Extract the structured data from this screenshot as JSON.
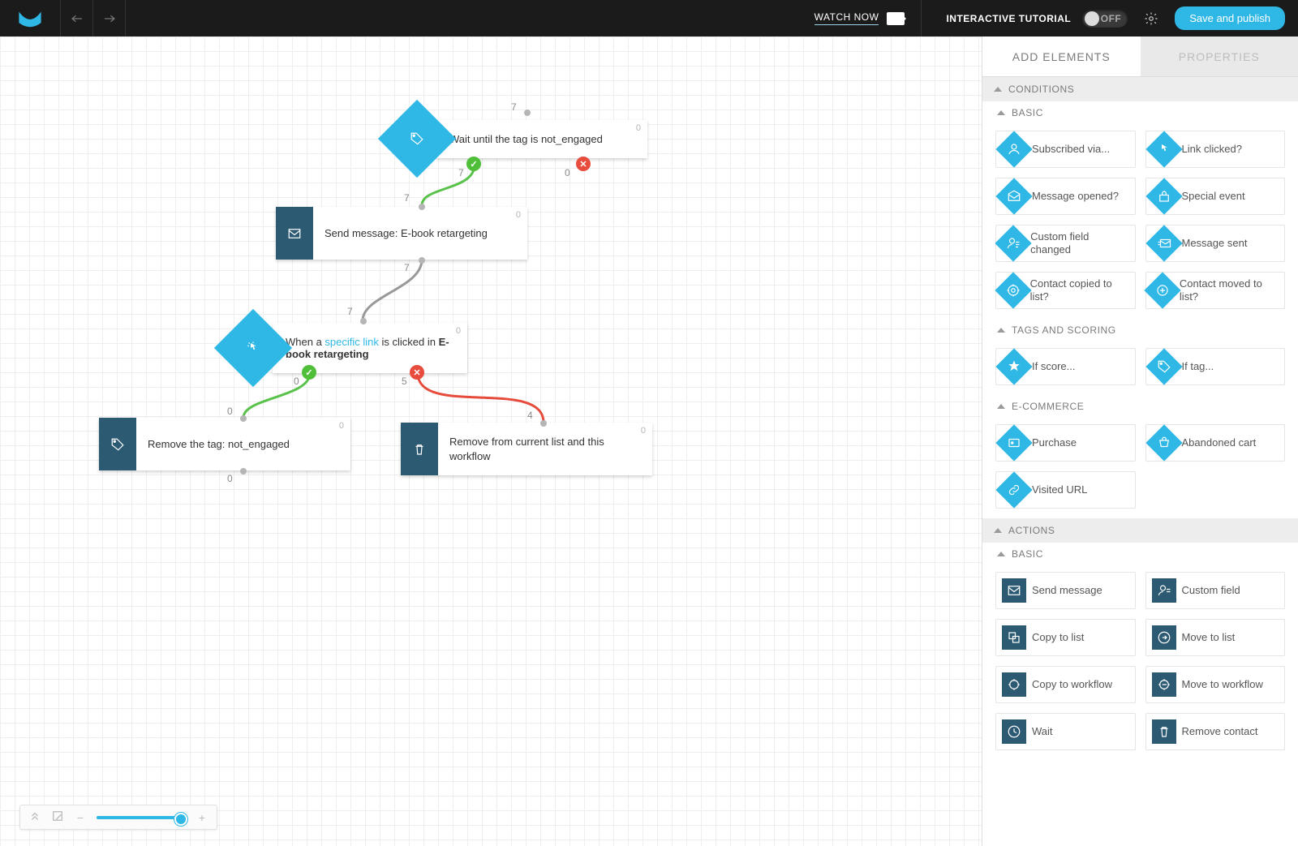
{
  "topbar": {
    "watch_now": "WATCH NOW",
    "tutorial_label": "INTERACTIVE TUTORIAL",
    "toggle_state": "OFF",
    "save_label": "Save and publish"
  },
  "canvas": {
    "nodes": {
      "n1": {
        "text": "Wait until the tag is not_engaged",
        "in_count": "7",
        "out1_count": "7",
        "out0_count": "0",
        "count_top": "0"
      },
      "n2": {
        "text": "Send message: E-book retargeting",
        "in_count": "7",
        "out_count": "7",
        "count_top": "0"
      },
      "n3": {
        "text_prefix": "When a ",
        "link_text": "specific link",
        "text_mid": " is clicked in ",
        "bold_text": "E-book retargeting",
        "in_count": "7",
        "out1_count": "0",
        "out0_count": "5",
        "count_top": "0"
      },
      "n4": {
        "text": "Remove the tag: not_engaged",
        "in_count": "0",
        "out_count": "0",
        "count_top": "0"
      },
      "n5": {
        "text": "Remove from current list and this workflow",
        "in_count": "4",
        "count_top": "0"
      }
    }
  },
  "sidebar": {
    "tabs": {
      "add": "ADD ELEMENTS",
      "props": "PROPERTIES"
    },
    "section_conditions": "CONDITIONS",
    "section_actions": "ACTIONS",
    "groups": {
      "basic": "BASIC",
      "tags": "TAGS AND SCORING",
      "ecom": "E-COMMERCE",
      "basic2": "BASIC"
    },
    "cond_basic": [
      "Subscribed via...",
      "Link clicked?",
      "Message opened?",
      "Special event",
      "Custom field changed",
      "Message sent",
      "Contact copied to list?",
      "Contact moved to list?"
    ],
    "cond_tags": [
      "If score...",
      "If tag..."
    ],
    "cond_ecom": [
      "Purchase",
      "Abandoned cart",
      "Visited URL"
    ],
    "act_basic": [
      "Send message",
      "Custom field",
      "Copy to list",
      "Move to list",
      "Copy to workflow",
      "Move to workflow",
      "Wait",
      "Remove contact"
    ]
  }
}
